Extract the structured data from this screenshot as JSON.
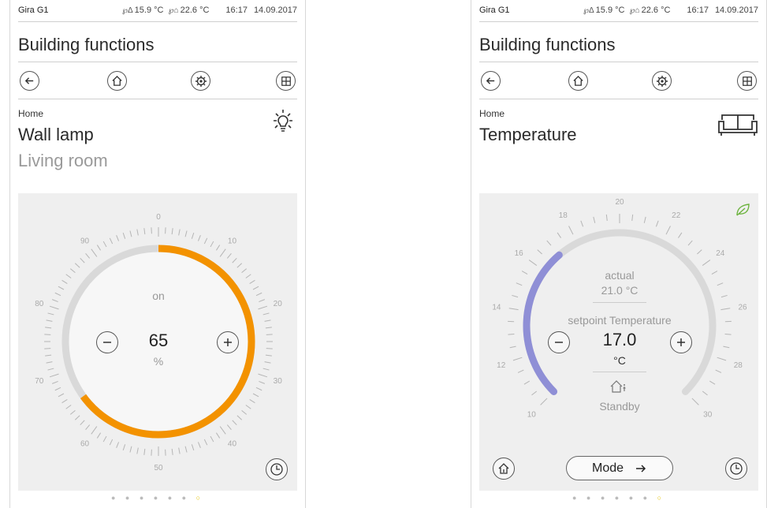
{
  "left": {
    "status": {
      "brand": "Gira G1",
      "outside_temp": "15.9 °C",
      "inside_temp": "22.6 °C",
      "time": "16:17",
      "date": "14.09.2017"
    },
    "title": "Building functions",
    "breadcrumb": "Home",
    "function_name": "Wall lamp",
    "room": "Living room",
    "state": "on",
    "value": "65",
    "unit": "%",
    "level_percent": 65,
    "scale_labels": [
      "0",
      "10",
      "20",
      "30",
      "40",
      "50",
      "60",
      "70",
      "80",
      "90"
    ],
    "colors": {
      "accent": "#f39200",
      "track": "#d9d9d9"
    }
  },
  "right": {
    "status": {
      "brand": "Gira G1",
      "outside_temp": "15.9 °C",
      "inside_temp": "22.6 °C",
      "time": "16:17",
      "date": "14.09.2017"
    },
    "title": "Building functions",
    "breadcrumb": "Home",
    "function_name": "Temperature",
    "actual_label": "actual",
    "actual_value": "21.0 °C",
    "setpoint_label": "setpoint Temperature",
    "setpoint_value": "17.0",
    "setpoint_unit": "°C",
    "mode_state": "Standby",
    "mode_button": "Mode",
    "scale_labels": [
      "10",
      "12",
      "14",
      "16",
      "18",
      "20",
      "22",
      "24",
      "26",
      "28",
      "30"
    ],
    "colors": {
      "accent": "#8f8fd6",
      "eco": "#6db33f",
      "track": "#d9d9d9"
    }
  },
  "page_indicator": {
    "count": 7,
    "active_index": 6
  }
}
